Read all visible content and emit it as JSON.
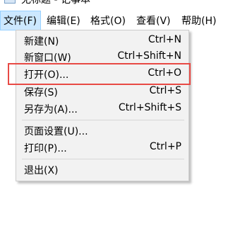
{
  "window": {
    "title": "无标题 - 记事本"
  },
  "menubar": {
    "items": [
      "文件(F)",
      "编辑(E)",
      "格式(O)",
      "查看(V)",
      "帮助(H)"
    ],
    "active": "文件(F)"
  },
  "file_menu": {
    "items": [
      {
        "label": "新建(N)",
        "shortcut": "Ctrl+N"
      },
      {
        "label": "新窗口(W)",
        "shortcut": "Ctrl+Shift+N"
      },
      {
        "label": "打开(O)...",
        "shortcut": "Ctrl+O"
      },
      {
        "label": "保存(S)",
        "shortcut": "Ctrl+S"
      },
      {
        "label": "另存为(A)...",
        "shortcut": "Ctrl+Shift+S"
      },
      {
        "label": "页面设置(U)...",
        "shortcut": ""
      },
      {
        "label": "打印(P)...",
        "shortcut": "Ctrl+P"
      },
      {
        "label": "退出(X)",
        "shortcut": ""
      }
    ],
    "highlighted": "打开(O)..."
  },
  "colors": {
    "highlight_border": "#e84a45",
    "menu_active_bg": "#cce8ff",
    "dropdown_bg": "#f2f2f2"
  }
}
